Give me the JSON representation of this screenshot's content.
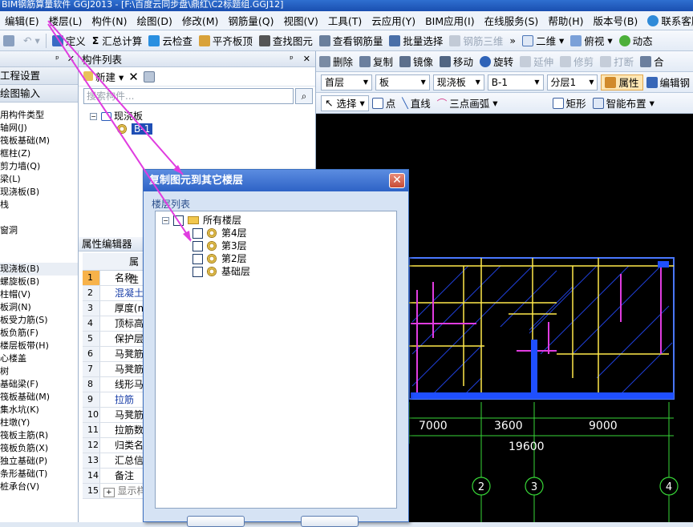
{
  "window": {
    "title": "BIM钢筋算量软件 GGJ2013 - [F:\\百度云同步盘\\鼎红\\C2标题组.GGJ12]"
  },
  "menu": [
    "编辑(E)",
    "楼层(L)",
    "构件(N)",
    "绘图(D)",
    "修改(M)",
    "钢筋量(Q)",
    "视图(V)",
    "工具(T)",
    "云应用(Y)",
    "BIM应用(I)",
    "在线服务(S)",
    "帮助(H)",
    "版本号(B)",
    "联系客服"
  ],
  "toolbar": {
    "items": [
      "定义",
      "汇总计算",
      "云检查",
      "平齐板顶",
      "查找图元",
      "查看钢筋量",
      "批量选择",
      "钢筋三维"
    ],
    "view2d": "二维",
    "view_mode": "俯视",
    "dynamic": "动态"
  },
  "left_panel": {
    "section_project": "工程设置",
    "section_draw": "绘图输入",
    "tree": [
      "用构件类型",
      "轴网(J)",
      "筏板基础(M)",
      "框柱(Z)",
      "剪力墙(Q)",
      "梁(L)",
      "现浇板(B)",
      "栈",
      "",
      "窗洞",
      "",
      "",
      "现浇板(B)",
      "螺旋板(B)",
      "柱帽(V)",
      "板洞(N)",
      "板受力筋(S)",
      "板负筋(F)",
      "楼层板带(H)",
      "心楼盖",
      "树",
      "基础梁(F)",
      "筏板基础(M)",
      "集水坑(K)",
      "柱墩(Y)",
      "筏板主筋(R)",
      "筏板负筋(X)",
      "独立基础(P)",
      "条形基础(T)",
      "桩承台(V)"
    ]
  },
  "component_list": {
    "title": "构件列表",
    "new_label": "新建",
    "search_placeholder": "搜索构件...",
    "tree_root": "现浇板",
    "tree_child": "B-1"
  },
  "property_editor": {
    "title": "属性编辑器",
    "header": "属性",
    "rows": [
      {
        "n": "1",
        "name": "名称"
      },
      {
        "n": "2",
        "name": "混凝土"
      },
      {
        "n": "3",
        "name": "厚度(m"
      },
      {
        "n": "4",
        "name": "顶标高"
      },
      {
        "n": "5",
        "name": "保护层"
      },
      {
        "n": "6",
        "name": "马凳筋"
      },
      {
        "n": "7",
        "name": "马凳筋"
      },
      {
        "n": "8",
        "name": "线形马"
      },
      {
        "n": "9",
        "name": "拉筋"
      },
      {
        "n": "10",
        "name": "马凳筋"
      },
      {
        "n": "11",
        "name": "拉筋数"
      },
      {
        "n": "12",
        "name": "归类名"
      },
      {
        "n": "13",
        "name": "汇总信"
      },
      {
        "n": "14",
        "name": "备注"
      },
      {
        "n": "15",
        "name": "显示样"
      }
    ]
  },
  "edit_toolbar": {
    "items": [
      "删除",
      "复制",
      "镜像",
      "移动",
      "旋转",
      "延伸",
      "修剪",
      "打断",
      "合"
    ],
    "floor": "首层",
    "type": "板",
    "subtype": "现浇板",
    "component": "B-1",
    "layer": "分层1",
    "property_btn": "属性",
    "edit_rebar": "编辑钢"
  },
  "draw_toolbar": {
    "items": [
      "选择",
      "点",
      "直线",
      "三点画弧",
      "矩形",
      "智能布置"
    ]
  },
  "dimensions": {
    "spans": [
      "7000",
      "3600",
      "9000"
    ],
    "total": "19600",
    "axes": [
      "2",
      "3",
      "4"
    ]
  },
  "dialog": {
    "title": "复制图元到其它楼层",
    "list_label": "楼层列表",
    "root": "所有楼层",
    "floors": [
      "第4层",
      "第3层",
      "第2层",
      "基础层"
    ]
  },
  "colors": {
    "title_blue": "#2e63c6",
    "accent_magenta": "#e03ce0",
    "drawing_bg": "#000000"
  }
}
